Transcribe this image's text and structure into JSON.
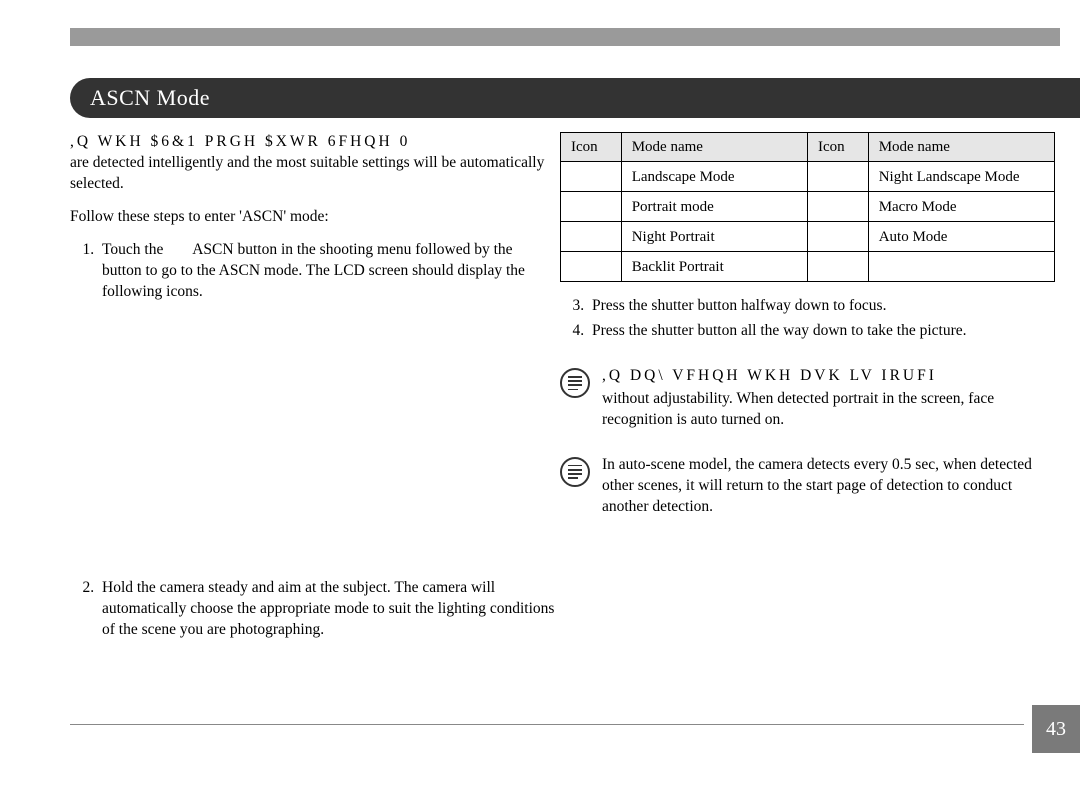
{
  "title": "ASCN Mode",
  "garbled1": ",Q WKH $6&1 PRGH $XWR 6FHQH 0",
  "intro_continue": "are detected intelligently and the most suitable settings will be automatically selected.",
  "follow_line": "Follow these steps to enter 'ASCN' mode:",
  "step1_a": "Touch the ",
  "step1_mid": "ASCN button in the shooting menu followed by the ",
  "step1_b": "button to go to the ASCN mode. The LCD screen should display the following icons.",
  "step2": "Hold the camera steady and aim at the subject. The camera will automatically choose the appropriate mode to suit the lighting conditions of the scene you are photographing.",
  "table": {
    "h_icon": "Icon",
    "h_mode": "Mode name",
    "rows": [
      {
        "m1": "Landscape Mode",
        "m2": "Night Landscape Mode"
      },
      {
        "m1": "Portrait mode",
        "m2": "Macro Mode"
      },
      {
        "m1": "Night Portrait",
        "m2": "Auto Mode"
      },
      {
        "m1": "Backlit Portrait",
        "m2": ""
      }
    ]
  },
  "step3": "Press the shutter button halfway down to focus.",
  "step4": "Press the shutter button all the way down to take the picture.",
  "note1_garbled": ",Q DQ\\ VFHQH  WKH  DVK LV IRUFI",
  "note1_text": "without adjustability. When detected portrait in the screen, face recognition is auto turned on.",
  "note2_text": "In auto-scene model, the camera detects every 0.5 sec, when detected other scenes, it will return to the start page of detection to conduct another detection.",
  "page_number": "43"
}
